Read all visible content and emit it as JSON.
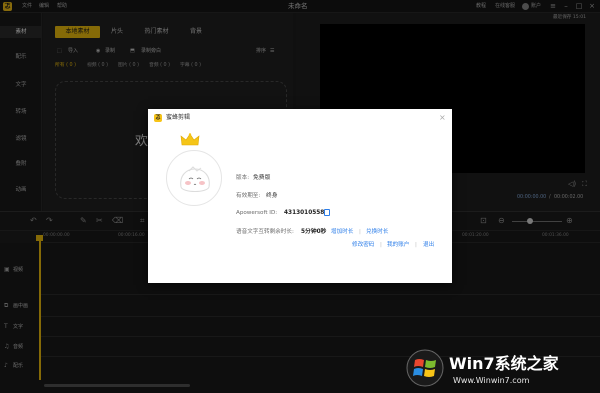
{
  "app": {
    "logo_glyph": "忑",
    "menu": [
      "文件",
      "编辑",
      "帮助"
    ],
    "window_title": "未命名",
    "right_menu": [
      "教程",
      "在线客服"
    ],
    "account": "账户",
    "autosave": "最近保存 15:01"
  },
  "nav": [
    "素材",
    "配乐",
    "文字",
    "转场",
    "滤镜",
    "叠附",
    "动画"
  ],
  "asset_tabs": [
    "本地素材",
    "片头",
    "热门素材",
    "背景"
  ],
  "asset_tools": {
    "import": "导入",
    "record": "录制",
    "mic": "录制旁白",
    "sort": "排序"
  },
  "filters": [
    "所有 ( 0 )",
    "视频 ( 0 )",
    "图片 ( 0 )",
    "音频 ( 0 )",
    "字幕 ( 0 )"
  ],
  "drop_hint": "欢",
  "preview": {
    "current_time": "00:00:00.00",
    "divider": "/",
    "total_time": "00:00:02.00"
  },
  "ruler": [
    "00:00:00.00",
    "00:00:16.00",
    "00:01:20.00",
    "00:01:36.00"
  ],
  "tracks": [
    "视频",
    "画中画",
    "文字",
    "音频",
    "配乐"
  ],
  "dialog": {
    "logo_glyph": "忑",
    "title": "蜜蜂剪辑",
    "close": "×",
    "version_label": "版本:",
    "version_value": "免费版",
    "validity_label": "有效期至:",
    "validity_value": "终身",
    "id_label": "Apowersoft ID:",
    "id_value": "4313010558",
    "speech_label": "语音文字互转剩余时长:",
    "speech_value": "5分钟0秒",
    "add_time": "增加时长",
    "redeem": "兑换时长",
    "sep": "|",
    "change_password": "修改密码",
    "my_account": "我的账户",
    "logout": "退出"
  },
  "watermark": {
    "brand": "Win7系统之家",
    "url": "Www.Winwin7.com"
  },
  "colors": {
    "accent": "#f2c10e",
    "link": "#2b7de9",
    "bg": "#1e1e1e"
  }
}
